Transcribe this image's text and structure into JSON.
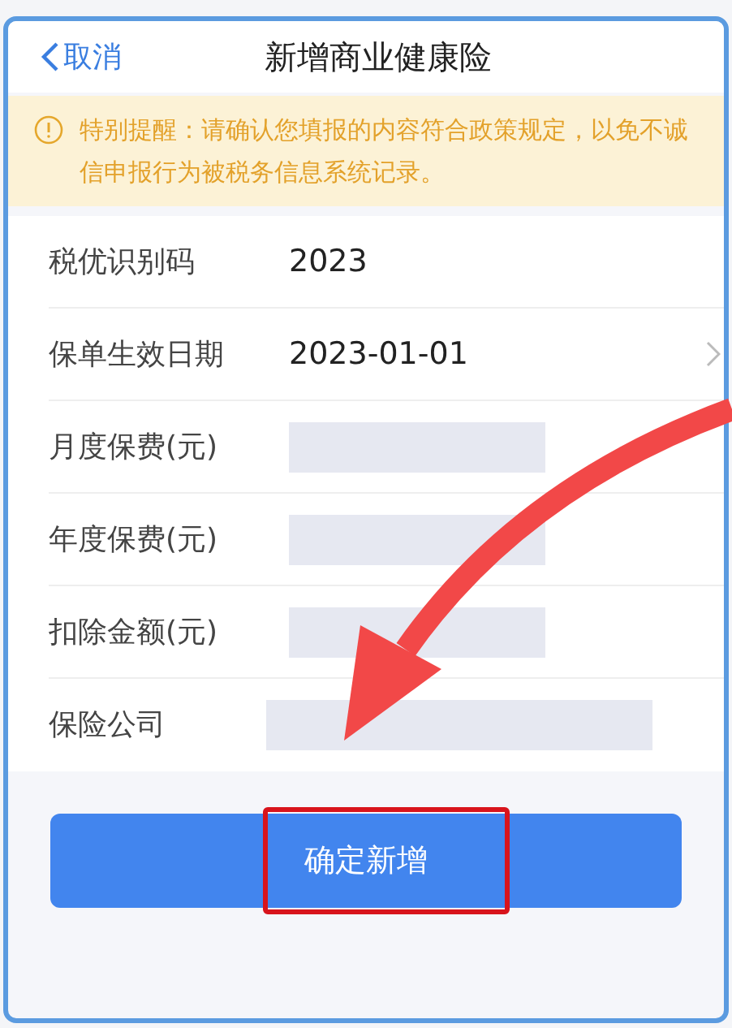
{
  "nav": {
    "back": "取消",
    "title": "新增商业健康险"
  },
  "notice": "特别提醒：请确认您填报的内容符合政策规定，以免不诚信申报行为被税务信息系统记录。",
  "rows": [
    {
      "label": "税优识别码",
      "kind": "text",
      "value": "2023"
    },
    {
      "label": "保单生效日期",
      "kind": "select",
      "value": "2023-01-01"
    },
    {
      "label": "月度保费(元)",
      "kind": "redacted"
    },
    {
      "label": "年度保费(元)",
      "kind": "redacted"
    },
    {
      "label": "扣除金额(元)",
      "kind": "redacted"
    },
    {
      "label": "保险公司",
      "kind": "redacted"
    }
  ],
  "submit": "确定新增",
  "annotation": {
    "highlight": true,
    "arrow": true
  }
}
